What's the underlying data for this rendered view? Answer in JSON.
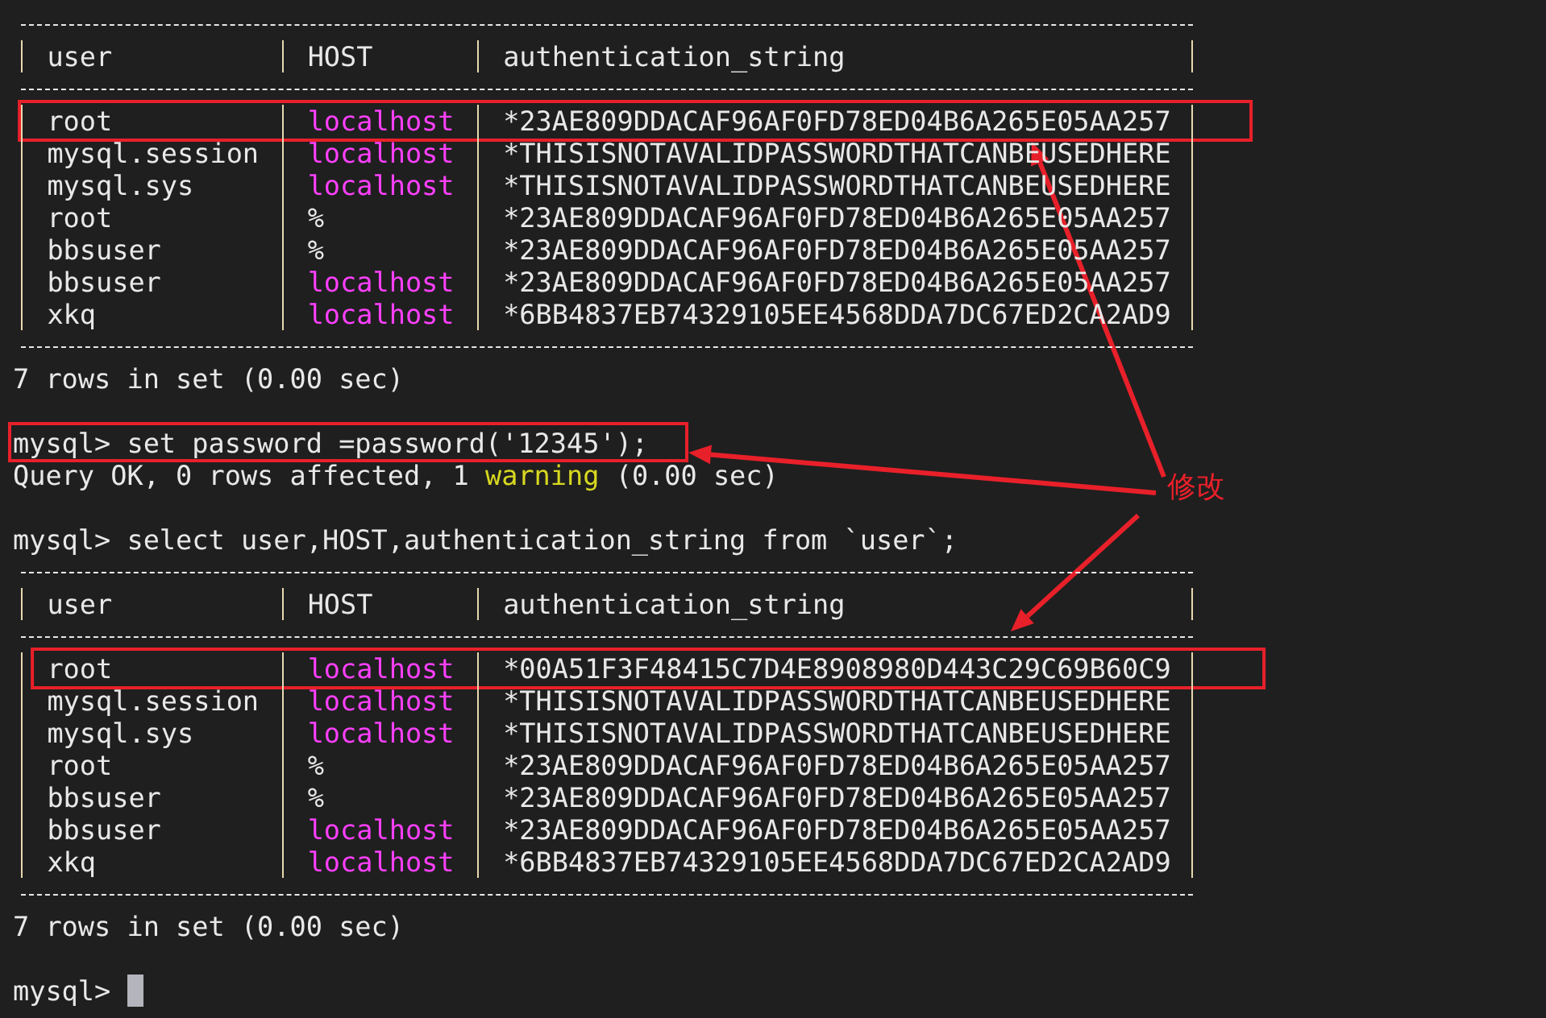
{
  "terminal": {
    "blocks": [
      {
        "kind": "table",
        "columns": [
          "user",
          "HOST",
          "authentication_string"
        ],
        "rows": [
          {
            "user": "root",
            "host": "localhost",
            "color": "#ff40ff",
            "auth": "*23AE809DDACAF96AF0FD78ED04B6A265E05AA257",
            "boxed": true
          },
          {
            "user": "mysql.session",
            "host": "localhost",
            "color": "#ff40ff",
            "auth": "*THISISNOTAVALIDPASSWORDTHATCANBEUSEDHERE",
            "boxed": false
          },
          {
            "user": "mysql.sys",
            "host": "localhost",
            "color": "#ff40ff",
            "auth": "*THISISNOTAVALIDPASSWORDTHATCANBEUSEDHERE",
            "boxed": false
          },
          {
            "user": "root",
            "host": "%",
            "color": "#e8e8e8",
            "auth": "*23AE809DDACAF96AF0FD78ED04B6A265E05AA257",
            "boxed": false
          },
          {
            "user": "bbsuser",
            "host": "%",
            "color": "#e8e8e8",
            "auth": "*23AE809DDACAF96AF0FD78ED04B6A265E05AA257",
            "boxed": false
          },
          {
            "user": "bbsuser",
            "host": "localhost",
            "color": "#ff40ff",
            "auth": "*23AE809DDACAF96AF0FD78ED04B6A265E05AA257",
            "boxed": false
          },
          {
            "user": "xkq",
            "host": "localhost",
            "color": "#ff40ff",
            "auth": "*6BB4837EB74329105EE4568DDA7DC67ED2CA2AD9",
            "boxed": false
          }
        ]
      },
      {
        "kind": "text",
        "text": "7 rows in set (0.00 sec)"
      },
      {
        "kind": "blank"
      },
      {
        "kind": "prompt",
        "text": "mysql> set password =password('12345');",
        "boxed": true
      },
      {
        "kind": "text",
        "text": "Query OK, 0 rows affected, 1 **warning** (0.00 sec)"
      },
      {
        "kind": "blank"
      },
      {
        "kind": "prompt",
        "text": "mysql> select user,HOST,authentication_string from `user`;",
        "boxed": false
      },
      {
        "kind": "table",
        "columns": [
          "user",
          "HOST",
          "authentication_string"
        ],
        "rows": [
          {
            "user": "root",
            "host": "localhost",
            "color": "#ff40ff",
            "auth": "*00A51F3F48415C7D4E8908980D443C29C69B60C9",
            "boxed": true
          },
          {
            "user": "mysql.session",
            "host": "localhost",
            "color": "#ff40ff",
            "auth": "*THISISNOTAVALIDPASSWORDTHATCANBEUSEDHERE",
            "boxed": false
          },
          {
            "user": "mysql.sys",
            "host": "localhost",
            "color": "#ff40ff",
            "auth": "*THISISNOTAVALIDPASSWORDTHATCANBEUSEDHERE",
            "boxed": false
          },
          {
            "user": "root",
            "host": "%",
            "color": "#e8e8e8",
            "auth": "*23AE809DDACAF96AF0FD78ED04B6A265E05AA257",
            "boxed": false
          },
          {
            "user": "bbsuser",
            "host": "%",
            "color": "#e8e8e8",
            "auth": "*23AE809DDACAF96AF0FD78ED04B6A265E05AA257",
            "boxed": false
          },
          {
            "user": "bbsuser",
            "host": "localhost",
            "color": "#ff40ff",
            "auth": "*23AE809DDACAF96AF0FD78ED04B6A265E05AA257",
            "boxed": false
          },
          {
            "user": "xkq",
            "host": "localhost",
            "color": "#ff40ff",
            "auth": "*6BB4837EB74329105EE4568DDA7DC67ED2CA2AD9",
            "boxed": false
          }
        ]
      },
      {
        "kind": "text",
        "text": "7 rows in set (0.00 sec)"
      },
      {
        "kind": "blank"
      },
      {
        "kind": "prompt",
        "text": "mysql>",
        "boxed": false,
        "cursor": true
      }
    ]
  },
  "annotation": {
    "label": "修改"
  }
}
